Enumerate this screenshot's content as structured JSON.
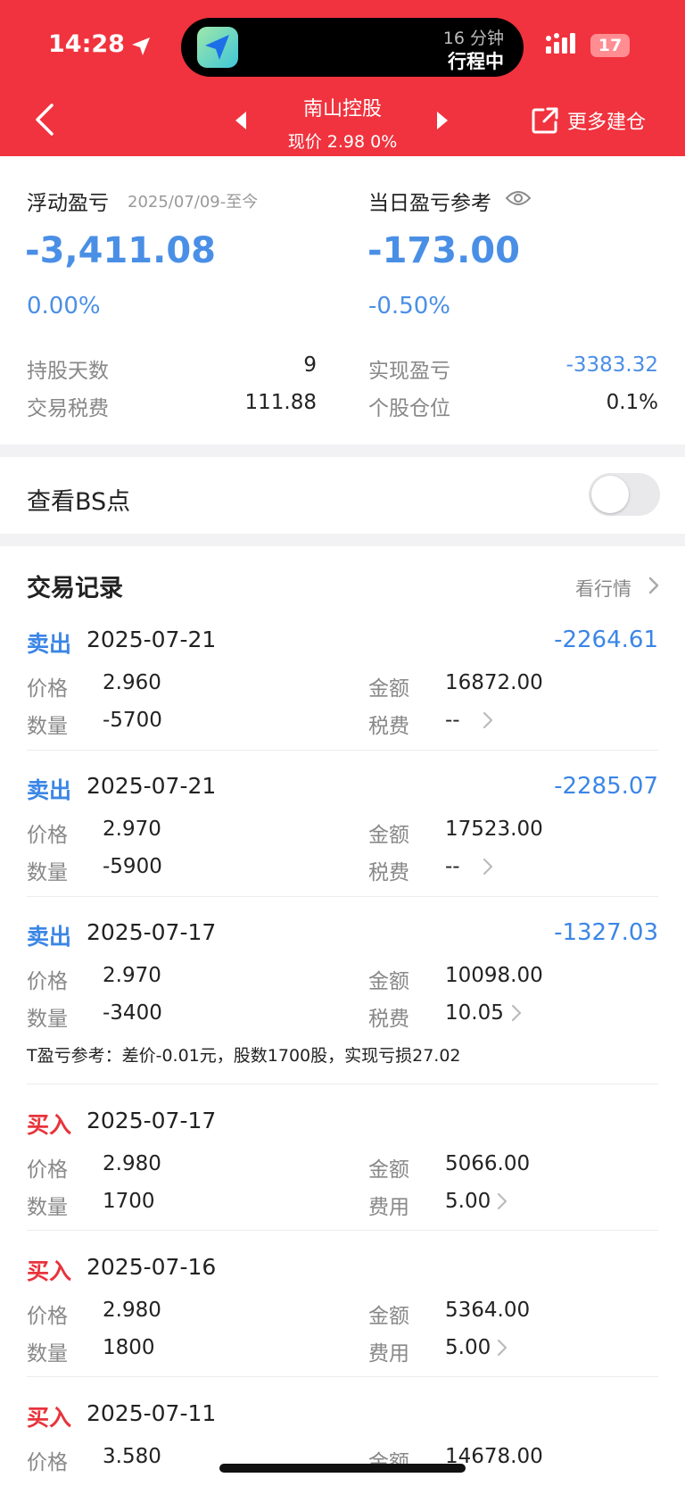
{
  "status": {
    "time": "14:28",
    "island_line1": "16 分钟",
    "island_line2": "行程中",
    "battery": "17"
  },
  "nav": {
    "stock_name": "南山控股",
    "price_line": "现价 2.98 0%",
    "more_label": "更多建仓"
  },
  "summary": {
    "floating_label": "浮动盈亏",
    "date_range": "2025/07/09-至今",
    "floating_value": "-3,411.08",
    "floating_pct": "0.00%",
    "daily_label": "当日盈亏参考",
    "daily_value": "-173.00",
    "daily_pct": "-0.50%",
    "hold_days_label": "持股天数",
    "hold_days_value": "9",
    "fee_label": "交易税费",
    "fee_value": "111.88",
    "realized_label": "实现盈亏",
    "realized_value": "-3383.32",
    "position_label": "个股仓位",
    "position_value": "0.1%"
  },
  "bs": {
    "label": "查看BS点",
    "enabled": false
  },
  "records": {
    "title": "交易记录",
    "market_link": "看行情",
    "items": [
      {
        "type": "卖出",
        "date": "2025-07-21",
        "pl": "-2264.61",
        "price_label": "价格",
        "price": "2.960",
        "amount_label": "金额",
        "amount": "16872.00",
        "qty_label": "数量",
        "qty": "-5700",
        "fee_label": "税费",
        "fee": "--"
      },
      {
        "type": "卖出",
        "date": "2025-07-21",
        "pl": "-2285.07",
        "price_label": "价格",
        "price": "2.970",
        "amount_label": "金额",
        "amount": "17523.00",
        "qty_label": "数量",
        "qty": "-5900",
        "fee_label": "税费",
        "fee": "--"
      },
      {
        "type": "卖出",
        "date": "2025-07-17",
        "pl": "-1327.03",
        "price_label": "价格",
        "price": "2.970",
        "amount_label": "金额",
        "amount": "10098.00",
        "qty_label": "数量",
        "qty": "-3400",
        "fee_label": "税费",
        "fee": "10.05",
        "note": "T盈亏参考：差价-0.01元，股数1700股，实现亏损27.02"
      },
      {
        "type": "买入",
        "date": "2025-07-17",
        "pl": "",
        "price_label": "价格",
        "price": "2.980",
        "amount_label": "金额",
        "amount": "5066.00",
        "qty_label": "数量",
        "qty": "1700",
        "fee_label": "费用",
        "fee": "5.00"
      },
      {
        "type": "买入",
        "date": "2025-07-16",
        "pl": "",
        "price_label": "价格",
        "price": "2.980",
        "amount_label": "金额",
        "amount": "5364.00",
        "qty_label": "数量",
        "qty": "1800",
        "fee_label": "费用",
        "fee": "5.00"
      },
      {
        "type": "买入",
        "date": "2025-07-11",
        "pl": "",
        "price_label": "价格",
        "price": "3.580",
        "amount_label": "金额",
        "amount": "14678.00"
      }
    ]
  }
}
